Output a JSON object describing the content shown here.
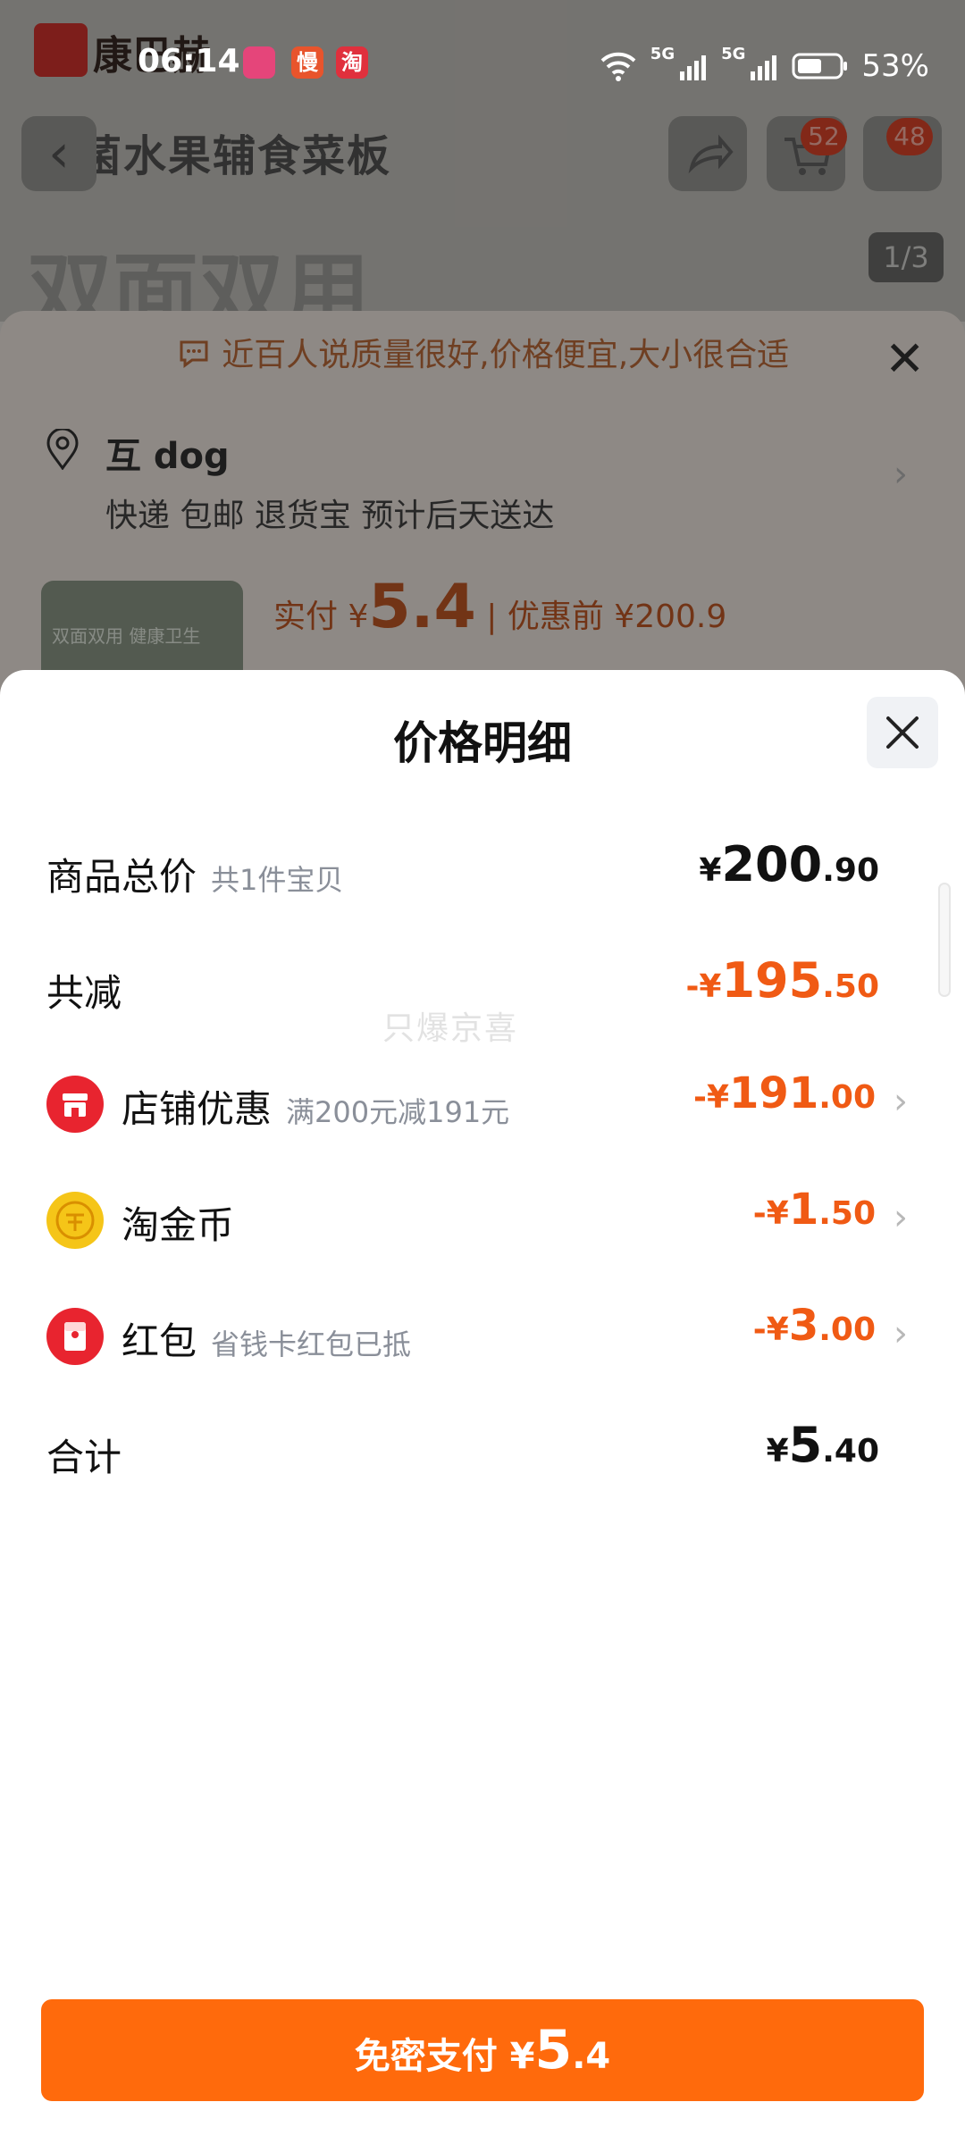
{
  "status_bar": {
    "time": "06:14",
    "app_icons": [
      "慢",
      "淘"
    ],
    "network": "5G",
    "battery_percent": "53%"
  },
  "background": {
    "brand_name": "康巴赫",
    "product_title": "抗菌水果辅食菜板",
    "hero_text": "双面双用",
    "cart_count": "52",
    "message_count": "48",
    "image_counter": "1/3",
    "notice": "近百人说质量很好,价格便宜,大小很合适",
    "address_name": "互 dog",
    "address_sub": "快递 包邮 退货宝 预计后天送达",
    "thumb_text": "双面双用 健康卫生",
    "price_label": "实付 ¥",
    "price_big": "5.4",
    "price_before": "| 优惠前 ¥200.9"
  },
  "sheet": {
    "title": "价格明细",
    "watermark": "只爆京喜",
    "rows": [
      {
        "label": "商品总价",
        "sub": "共1件宝贝",
        "sign": "",
        "symbol": "¥",
        "int": "200",
        "dec": ".90"
      },
      {
        "label": "共减",
        "sub": "",
        "sign": "-",
        "symbol": "¥",
        "int": "195",
        "dec": ".50"
      },
      {
        "label": "店铺优惠",
        "sub": "满200元减191元",
        "sign": "-",
        "symbol": "¥",
        "int": "191",
        "dec": ".00"
      },
      {
        "label": "淘金币",
        "sub": "",
        "sign": "-",
        "symbol": "¥",
        "int": "1",
        "dec": ".50"
      },
      {
        "label": "红包",
        "sub": "省钱卡红包已抵",
        "sign": "-",
        "symbol": "¥",
        "int": "3",
        "dec": ".00"
      },
      {
        "label": "合计",
        "sub": "",
        "sign": "",
        "symbol": "¥",
        "int": "5",
        "dec": ".40"
      }
    ],
    "pay_button": {
      "text": "免密支付 ¥",
      "int": "5",
      "dec": ".4"
    }
  },
  "colors": {
    "accent": "#ff6a0c",
    "discount": "#f05a14",
    "shop_icon": "#e8242f",
    "coin_icon": "#f5c518",
    "redpacket_icon": "#e8242f"
  },
  "icons": [
    "location-pin-icon",
    "chat-bubble-icon",
    "close-icon",
    "store-icon",
    "coin-icon",
    "red-packet-icon",
    "chevron-right-icon",
    "share-icon",
    "cart-icon"
  ]
}
